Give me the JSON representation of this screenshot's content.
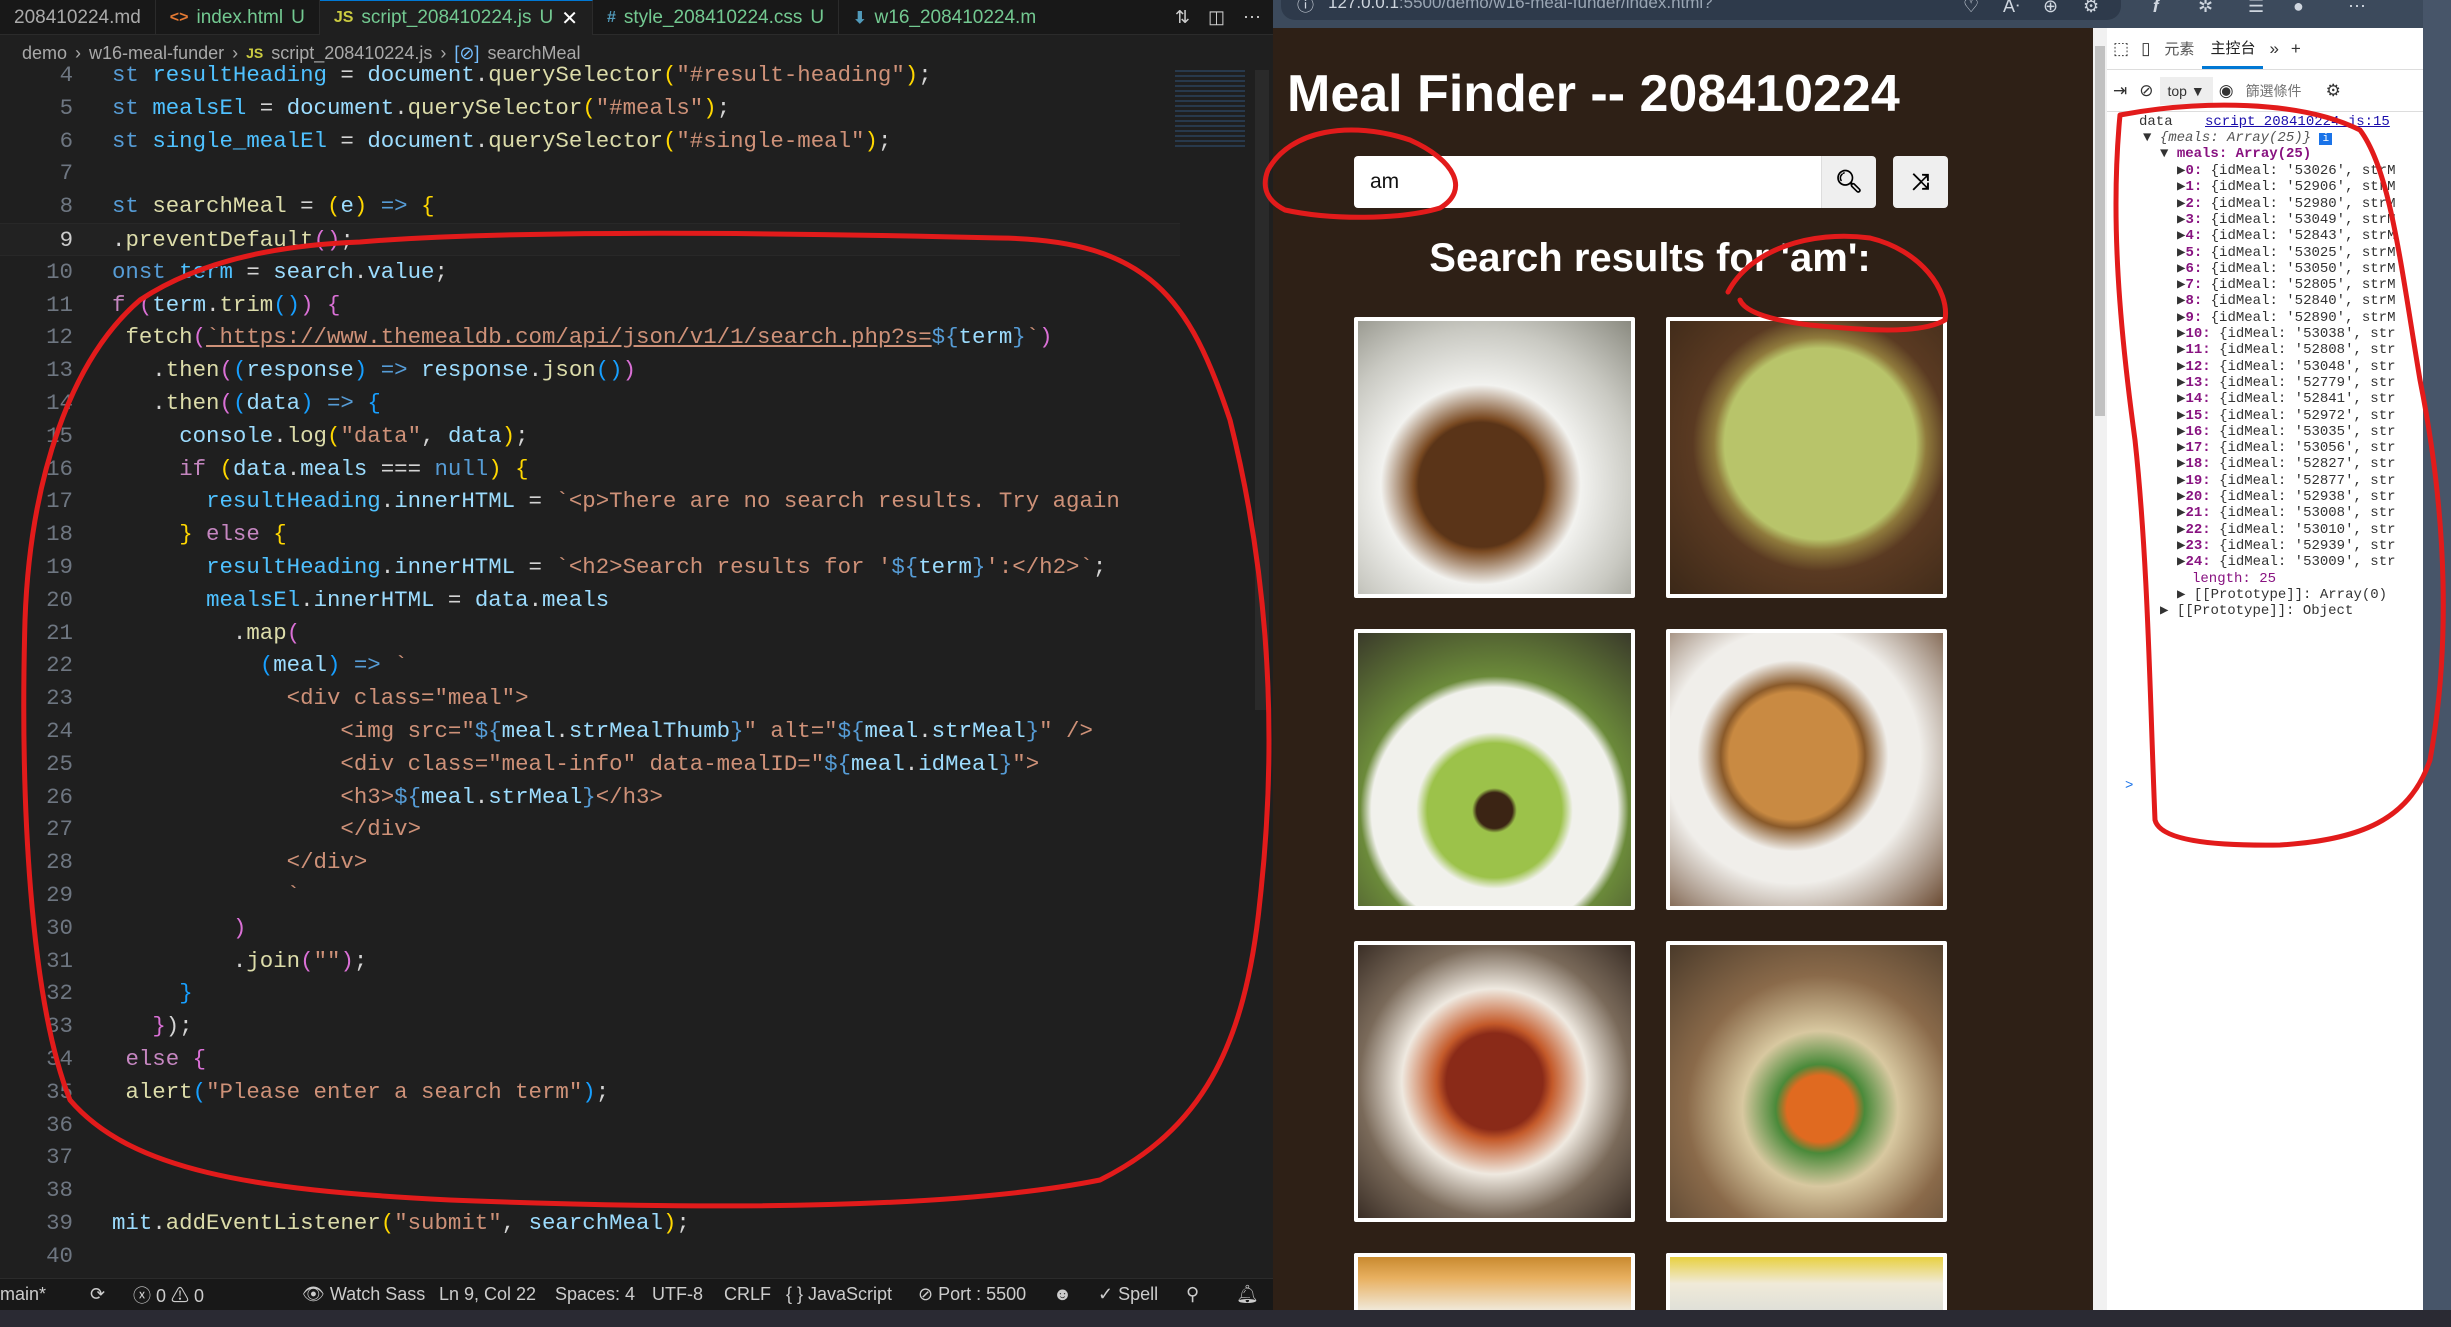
{
  "editor": {
    "tabs": [
      {
        "icon": "",
        "label": "208410224.md",
        "active": false
      },
      {
        "icon": "<>",
        "label": "index.html",
        "status": "U",
        "active": false
      },
      {
        "icon": "JS",
        "label": "script_208410224.js",
        "status": "U",
        "active": true
      },
      {
        "icon": "#",
        "label": "style_208410224.css",
        "status": "U",
        "active": false
      },
      {
        "icon": "⬇",
        "label": "w16_208410224.m",
        "active": false
      }
    ],
    "breadcrumb": [
      "demo",
      "w16-meal-funder",
      "script_208410224.js",
      "searchMeal"
    ],
    "current_line": 9,
    "lines": [
      {
        "n": 4,
        "t": [
          [
            "k",
            "st "
          ],
          [
            "c",
            "resultHeading"
          ],
          [
            "p",
            " = "
          ],
          [
            "v",
            "document"
          ],
          [
            "p",
            "."
          ],
          [
            "f",
            "querySelector"
          ],
          [
            "b",
            "("
          ],
          [
            "s",
            "\"#result-heading\""
          ],
          [
            "b",
            ")"
          ],
          [
            "p",
            ";"
          ]
        ]
      },
      {
        "n": 5,
        "t": [
          [
            "k",
            "st "
          ],
          [
            "c",
            "mealsEl"
          ],
          [
            "p",
            " = "
          ],
          [
            "v",
            "document"
          ],
          [
            "p",
            "."
          ],
          [
            "f",
            "querySelector"
          ],
          [
            "b",
            "("
          ],
          [
            "s",
            "\"#meals\""
          ],
          [
            "b",
            ")"
          ],
          [
            "p",
            ";"
          ]
        ]
      },
      {
        "n": 6,
        "t": [
          [
            "k",
            "st "
          ],
          [
            "c",
            "single_mealEl"
          ],
          [
            "p",
            " = "
          ],
          [
            "v",
            "document"
          ],
          [
            "p",
            "."
          ],
          [
            "f",
            "querySelector"
          ],
          [
            "b",
            "("
          ],
          [
            "s",
            "\"#single-meal\""
          ],
          [
            "b",
            ")"
          ],
          [
            "p",
            ";"
          ]
        ]
      },
      {
        "n": 7,
        "t": []
      },
      {
        "n": 8,
        "t": [
          [
            "k",
            "st "
          ],
          [
            "f",
            "searchMeal"
          ],
          [
            "p",
            " = "
          ],
          [
            "b",
            "("
          ],
          [
            "v",
            "e"
          ],
          [
            "b",
            ")"
          ],
          [
            "k",
            " => "
          ],
          [
            "b",
            "{"
          ]
        ]
      },
      {
        "n": 9,
        "t": [
          [
            "p",
            "."
          ],
          [
            "f",
            "preventDefault"
          ],
          [
            "b2",
            "()"
          ],
          [
            "p",
            ";"
          ]
        ]
      },
      {
        "n": 10,
        "t": [
          [
            "k",
            "onst "
          ],
          [
            "c",
            "term"
          ],
          [
            "p",
            " = "
          ],
          [
            "v",
            "search"
          ],
          [
            "p",
            "."
          ],
          [
            "v",
            "value"
          ],
          [
            "p",
            ";"
          ]
        ]
      },
      {
        "n": 11,
        "t": [
          [
            "kw2",
            "f "
          ],
          [
            "b2",
            "("
          ],
          [
            "v",
            "term"
          ],
          [
            "p",
            "."
          ],
          [
            "f",
            "trim"
          ],
          [
            "b3",
            "()"
          ],
          [
            "b2",
            ")"
          ],
          [
            "p",
            " "
          ],
          [
            "b2",
            "{"
          ]
        ]
      },
      {
        "n": 12,
        "t": [
          [
            "p",
            " "
          ],
          [
            "f",
            "fetch"
          ],
          [
            "b2",
            "("
          ],
          [
            "u",
            "`https://www.themealdb.com/api/json/v1/1/search.php?s="
          ],
          [
            "k",
            "${"
          ],
          [
            "v",
            "term"
          ],
          [
            "k",
            "}"
          ],
          [
            "s",
            "`"
          ],
          [
            "b2",
            ")"
          ]
        ]
      },
      {
        "n": 13,
        "t": [
          [
            "p",
            "   ."
          ],
          [
            "f",
            "then"
          ],
          [
            "b2",
            "("
          ],
          [
            "b3",
            "("
          ],
          [
            "v",
            "response"
          ],
          [
            "b3",
            ")"
          ],
          [
            "k",
            " => "
          ],
          [
            "v",
            "response"
          ],
          [
            "p",
            "."
          ],
          [
            "f",
            "json"
          ],
          [
            "b3",
            "()"
          ],
          [
            "b2",
            ")"
          ]
        ]
      },
      {
        "n": 14,
        "t": [
          [
            "p",
            "   ."
          ],
          [
            "f",
            "then"
          ],
          [
            "b2",
            "("
          ],
          [
            "b3",
            "("
          ],
          [
            "v",
            "data"
          ],
          [
            "b3",
            ")"
          ],
          [
            "k",
            " => "
          ],
          [
            "b3",
            "{"
          ]
        ]
      },
      {
        "n": 15,
        "t": [
          [
            "p",
            "     "
          ],
          [
            "v",
            "console"
          ],
          [
            "p",
            "."
          ],
          [
            "f",
            "log"
          ],
          [
            "b",
            "("
          ],
          [
            "s",
            "\"data\""
          ],
          [
            "p",
            ", "
          ],
          [
            "v",
            "data"
          ],
          [
            "b",
            ")"
          ],
          [
            "p",
            ";"
          ]
        ]
      },
      {
        "n": 16,
        "t": [
          [
            "p",
            "     "
          ],
          [
            "kw2",
            "if "
          ],
          [
            "b",
            "("
          ],
          [
            "v",
            "data"
          ],
          [
            "p",
            "."
          ],
          [
            "v",
            "meals"
          ],
          [
            "p",
            " === "
          ],
          [
            "k",
            "null"
          ],
          [
            "b",
            ")"
          ],
          [
            "p",
            " "
          ],
          [
            "b",
            "{"
          ]
        ]
      },
      {
        "n": 17,
        "t": [
          [
            "p",
            "       "
          ],
          [
            "c",
            "resultHeading"
          ],
          [
            "p",
            "."
          ],
          [
            "v",
            "innerHTML"
          ],
          [
            "p",
            " = "
          ],
          [
            "s",
            "`<p>There are no search results. Try again"
          ]
        ]
      },
      {
        "n": 18,
        "t": [
          [
            "p",
            "     "
          ],
          [
            "b",
            "}"
          ],
          [
            "kw2",
            " else "
          ],
          [
            "b",
            "{"
          ]
        ]
      },
      {
        "n": 19,
        "t": [
          [
            "p",
            "       "
          ],
          [
            "c",
            "resultHeading"
          ],
          [
            "p",
            "."
          ],
          [
            "v",
            "innerHTML"
          ],
          [
            "p",
            " = "
          ],
          [
            "s",
            "`<h2>Search results for '"
          ],
          [
            "k",
            "${"
          ],
          [
            "v",
            "term"
          ],
          [
            "k",
            "}"
          ],
          [
            "s",
            "':</h2>`"
          ],
          [
            "p",
            ";"
          ]
        ]
      },
      {
        "n": 20,
        "t": [
          [
            "p",
            "       "
          ],
          [
            "c",
            "mealsEl"
          ],
          [
            "p",
            "."
          ],
          [
            "v",
            "innerHTML"
          ],
          [
            "p",
            " = "
          ],
          [
            "v",
            "data"
          ],
          [
            "p",
            "."
          ],
          [
            "v",
            "meals"
          ]
        ]
      },
      {
        "n": 21,
        "t": [
          [
            "p",
            "         ."
          ],
          [
            "f",
            "map"
          ],
          [
            "b2",
            "("
          ]
        ]
      },
      {
        "n": 22,
        "t": [
          [
            "p",
            "           "
          ],
          [
            "b3",
            "("
          ],
          [
            "v",
            "meal"
          ],
          [
            "b3",
            ")"
          ],
          [
            "k",
            " => "
          ],
          [
            "s",
            "`"
          ]
        ]
      },
      {
        "n": 23,
        "t": [
          [
            "s",
            "             <div class=\"meal\">"
          ]
        ]
      },
      {
        "n": 24,
        "t": [
          [
            "s",
            "                 <img src=\""
          ],
          [
            "k",
            "${"
          ],
          [
            "v",
            "meal"
          ],
          [
            "p",
            "."
          ],
          [
            "v",
            "strMealThumb"
          ],
          [
            "k",
            "}"
          ],
          [
            "s",
            "\" alt=\""
          ],
          [
            "k",
            "${"
          ],
          [
            "v",
            "meal"
          ],
          [
            "p",
            "."
          ],
          [
            "v",
            "strMeal"
          ],
          [
            "k",
            "}"
          ],
          [
            "s",
            "\" />"
          ]
        ]
      },
      {
        "n": 25,
        "t": [
          [
            "s",
            "                 <div class=\"meal-info\" data-mealID=\""
          ],
          [
            "k",
            "${"
          ],
          [
            "v",
            "meal"
          ],
          [
            "p",
            "."
          ],
          [
            "v",
            "idMeal"
          ],
          [
            "k",
            "}"
          ],
          [
            "s",
            "\">"
          ]
        ]
      },
      {
        "n": 26,
        "t": [
          [
            "s",
            "                 <h3>"
          ],
          [
            "k",
            "${"
          ],
          [
            "v",
            "meal"
          ],
          [
            "p",
            "."
          ],
          [
            "v",
            "strMeal"
          ],
          [
            "k",
            "}"
          ],
          [
            "s",
            "</h3>"
          ]
        ]
      },
      {
        "n": 27,
        "t": [
          [
            "s",
            "                 </div>"
          ]
        ]
      },
      {
        "n": 28,
        "t": [
          [
            "s",
            "             </div>"
          ]
        ]
      },
      {
        "n": 29,
        "t": [
          [
            "s",
            "             `"
          ]
        ]
      },
      {
        "n": 30,
        "t": [
          [
            "p",
            "         "
          ],
          [
            "b2",
            ")"
          ]
        ]
      },
      {
        "n": 31,
        "t": [
          [
            "p",
            "         ."
          ],
          [
            "f",
            "join"
          ],
          [
            "b2",
            "("
          ],
          [
            "s",
            "\"\""
          ],
          [
            "b2",
            ")"
          ],
          [
            "p",
            ";"
          ]
        ]
      },
      {
        "n": 32,
        "t": [
          [
            "p",
            "     "
          ],
          [
            "b3",
            "}"
          ]
        ]
      },
      {
        "n": 33,
        "t": [
          [
            "p",
            "   "
          ],
          [
            "b2",
            "}"
          ],
          [
            "p",
            ");"
          ]
        ]
      },
      {
        "n": 34,
        "t": [
          [
            "p",
            " "
          ],
          [
            "kw2",
            "else "
          ],
          [
            "b2",
            "{"
          ]
        ]
      },
      {
        "n": 35,
        "t": [
          [
            "p",
            " "
          ],
          [
            "f",
            "alert"
          ],
          [
            "b3",
            "("
          ],
          [
            "s",
            "\"Please enter a search term\""
          ],
          [
            "b3",
            ")"
          ],
          [
            "p",
            ";"
          ]
        ]
      },
      {
        "n": 36,
        "t": []
      },
      {
        "n": 37,
        "t": []
      },
      {
        "n": 38,
        "t": []
      },
      {
        "n": 39,
        "t": [
          [
            "v",
            "mit"
          ],
          [
            "p",
            "."
          ],
          [
            "f",
            "addEventListener"
          ],
          [
            "b",
            "("
          ],
          [
            "s",
            "\"submit\""
          ],
          [
            "p",
            ", "
          ],
          [
            "v",
            "searchMeal"
          ],
          [
            "b",
            ")"
          ],
          [
            "p",
            ";"
          ]
        ]
      },
      {
        "n": 40,
        "t": []
      }
    ],
    "status": {
      "branch": "main*",
      "errors": "0",
      "warnings": "0",
      "watch_sass": "Watch Sass",
      "position": "Ln 9, Col 22",
      "spaces": "Spaces: 4",
      "encoding": "UTF-8",
      "eol": "CRLF",
      "language": "{ } JavaScript",
      "port": "Port : 5500",
      "spell": "✓ Spell"
    }
  },
  "browser": {
    "url_host": "127.0.0.1",
    "url_path": ":5500/demo/w16-meal-funder/index.html?"
  },
  "page": {
    "title": "Meal Finder -- 208410224",
    "search_value": "am",
    "result_heading": "Search results for 'am':",
    "meals_visible": 8
  },
  "devtools": {
    "tabs": [
      "元素",
      "主控台"
    ],
    "active_tab": "主控台",
    "context": "top",
    "filter_placeholder": "篩選條件",
    "log_label": "data",
    "log_source": "script_208410224.js:15",
    "object_summary": "{meals: Array(25)}",
    "meals_label": "meals: Array(25)",
    "items": [
      {
        "i": "0:",
        "p": "{idMeal: '53026', strM"
      },
      {
        "i": "1:",
        "p": "{idMeal: '52906', strM"
      },
      {
        "i": "2:",
        "p": "{idMeal: '52980', strM"
      },
      {
        "i": "3:",
        "p": "{idMeal: '53049', strM"
      },
      {
        "i": "4:",
        "p": "{idMeal: '52843', strM"
      },
      {
        "i": "5:",
        "p": "{idMeal: '53025', strM"
      },
      {
        "i": "6:",
        "p": "{idMeal: '53050', strM"
      },
      {
        "i": "7:",
        "p": "{idMeal: '52805', strM"
      },
      {
        "i": "8:",
        "p": "{idMeal: '52840', strM"
      },
      {
        "i": "9:",
        "p": "{idMeal: '52890', strM"
      },
      {
        "i": "10:",
        "p": "{idMeal: '53038', str"
      },
      {
        "i": "11:",
        "p": "{idMeal: '52808', str"
      },
      {
        "i": "12:",
        "p": "{idMeal: '53048', str"
      },
      {
        "i": "13:",
        "p": "{idMeal: '52779', str"
      },
      {
        "i": "14:",
        "p": "{idMeal: '52841', str"
      },
      {
        "i": "15:",
        "p": "{idMeal: '52972', str"
      },
      {
        "i": "16:",
        "p": "{idMeal: '53035', str"
      },
      {
        "i": "17:",
        "p": "{idMeal: '53056', str"
      },
      {
        "i": "18:",
        "p": "{idMeal: '52827', str"
      },
      {
        "i": "19:",
        "p": "{idMeal: '52877', str"
      },
      {
        "i": "20:",
        "p": "{idMeal: '52938', str"
      },
      {
        "i": "21:",
        "p": "{idMeal: '53008', str"
      },
      {
        "i": "22:",
        "p": "{idMeal: '53010', str"
      },
      {
        "i": "23:",
        "p": "{idMeal: '52939', str"
      },
      {
        "i": "24:",
        "p": "{idMeal: '53009', str"
      }
    ],
    "length_label": "length: 25",
    "proto_array": "[[Prototype]]: Array(0)",
    "proto_object": "[[Prototype]]: Object",
    "prompt": ">"
  },
  "colors": {
    "page_bg": "#2e2016",
    "annotation": "#e21b1b",
    "accent": "#0078d4"
  }
}
